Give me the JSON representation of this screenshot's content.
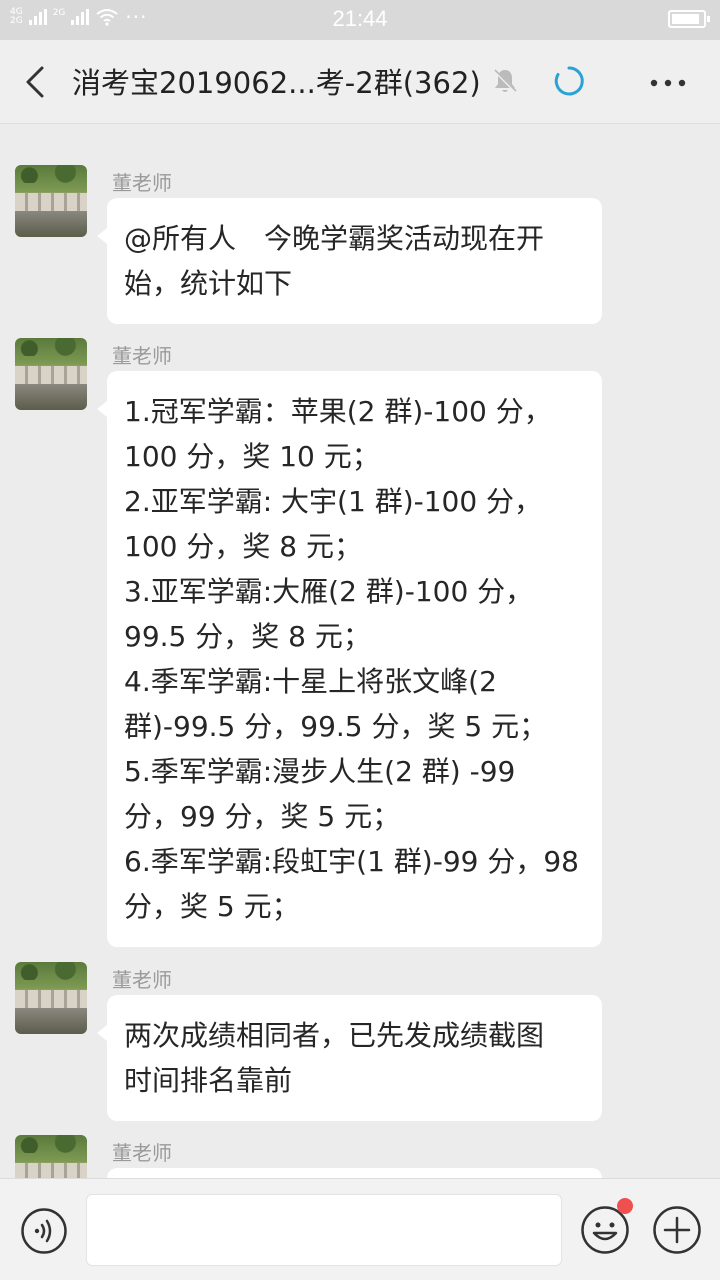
{
  "status_bar": {
    "network_top": "4G",
    "network_bottom": "2G",
    "network_label2": "2G",
    "time": "21:44",
    "battery_level": 0.8
  },
  "header": {
    "title": "消考宝2019062...考-2群(362)",
    "icons": [
      "back-icon",
      "mute-bell-icon",
      "loading-icon",
      "more-icon"
    ]
  },
  "messages": [
    {
      "sender": "董老师",
      "lines": [
        "@所有人　今晚学霸奖活动现在开",
        "始，统计如下"
      ]
    },
    {
      "sender": "董老师",
      "lines": [
        "1.冠军学霸：苹果(2 群)-100 分，",
        "100 分，奖 10 元；",
        "2.亚军学霸: 大宇(1 群)-100 分，",
        "100 分，奖 8 元；",
        "3.亚军学霸:大雁(2 群)-100 分，",
        "99.5 分，奖 8 元；",
        "4.季军学霸:十星上将张文峰(2",
        "群)-99.5 分，99.5 分，奖 5 元；",
        "5.季军学霸:漫步人生(2 群) -99",
        "分，99 分，奖 5 元；",
        "6.季军学霸:段虹宇(1 群)-99 分，98",
        "分，奖 5 元；"
      ]
    },
    {
      "sender": "董老师",
      "lines": [
        "两次成绩相同者，已先发成绩截图",
        "时间排名靠前"
      ]
    },
    {
      "sender": "董老师",
      "lines": []
    }
  ],
  "input_bar": {
    "placeholder": "",
    "icons": [
      "voice-icon",
      "emoji-icon",
      "plus-icon"
    ],
    "emoji_badge_color": "#f04f4f"
  }
}
